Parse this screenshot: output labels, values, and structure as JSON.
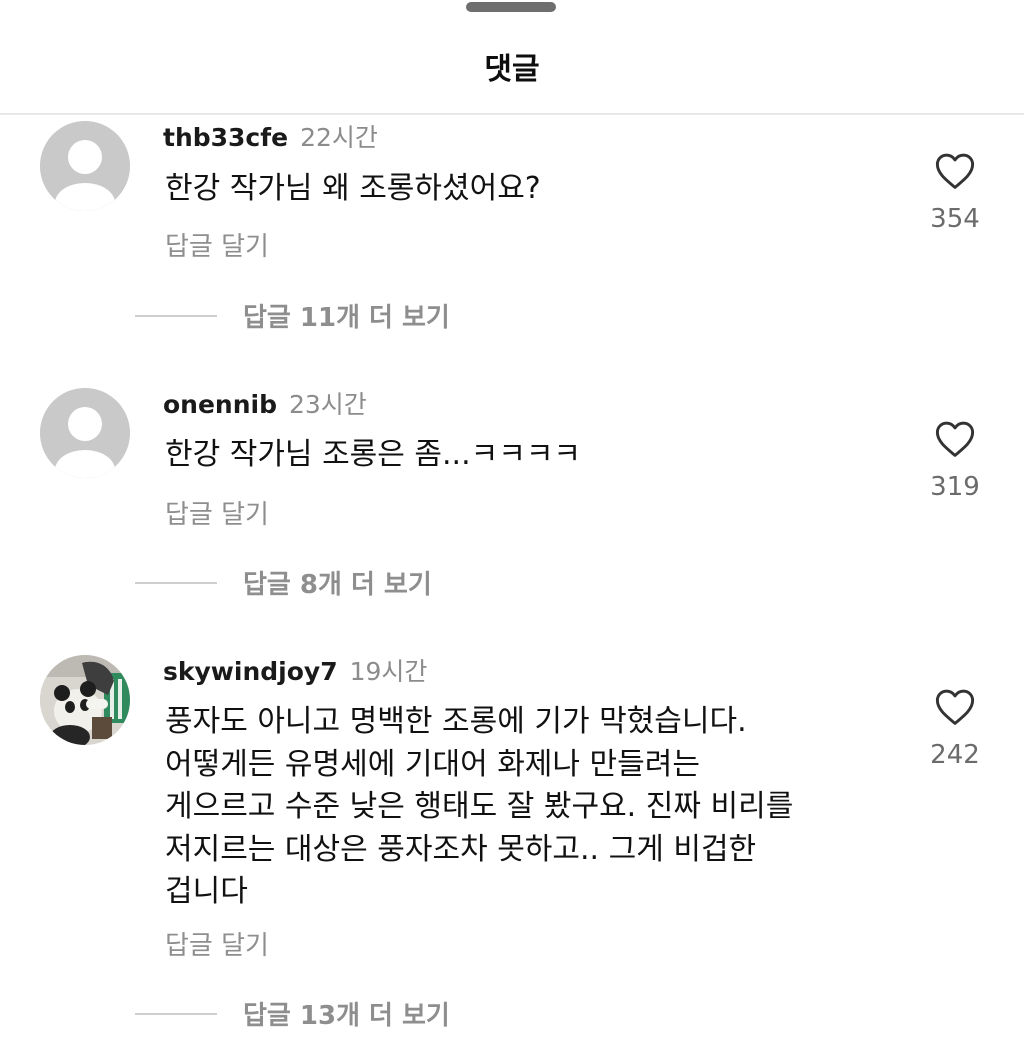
{
  "sheet": {
    "title": "댓글"
  },
  "comments": [
    {
      "username": "thb33cfe",
      "time": "22시간",
      "text": "한강 작가님 왜 조롱하셨어요?",
      "reply_label": "답글 달기",
      "likes": "354",
      "view_replies": "답글 11개 더 보기"
    },
    {
      "username": "onennib",
      "time": "23시간",
      "text": "한강 작가님 조롱은 좀...ㅋㅋㅋㅋ",
      "reply_label": "답글 달기",
      "likes": "319",
      "view_replies": "답글 8개 더 보기"
    },
    {
      "username": "skywindjoy7",
      "time": "19시간",
      "text": "풍자도 아니고 명백한 조롱에 기가 막혔습니다.\n어떻게든 유명세에 기대어 화제나 만들려는\n게으르고 수준 낮은 행태도 잘 봤구요. 진짜 비리를\n저지르는 대상은 풍자조차 못하고.. 그게 비겁한\n겁니다",
      "reply_label": "답글 달기",
      "likes": "242",
      "view_replies": "답글 13개 더 보기"
    }
  ],
  "icons": {
    "like": "heart-outline-icon",
    "default_avatar": "default-avatar-icon",
    "photo_avatar": "panda-photo-avatar"
  },
  "colors": {
    "text": "#111111",
    "secondary": "#8e8e8e",
    "time": "#8c8c8c",
    "like_count": "#6b6b6b",
    "avatar_bg": "#c9c9c9"
  }
}
